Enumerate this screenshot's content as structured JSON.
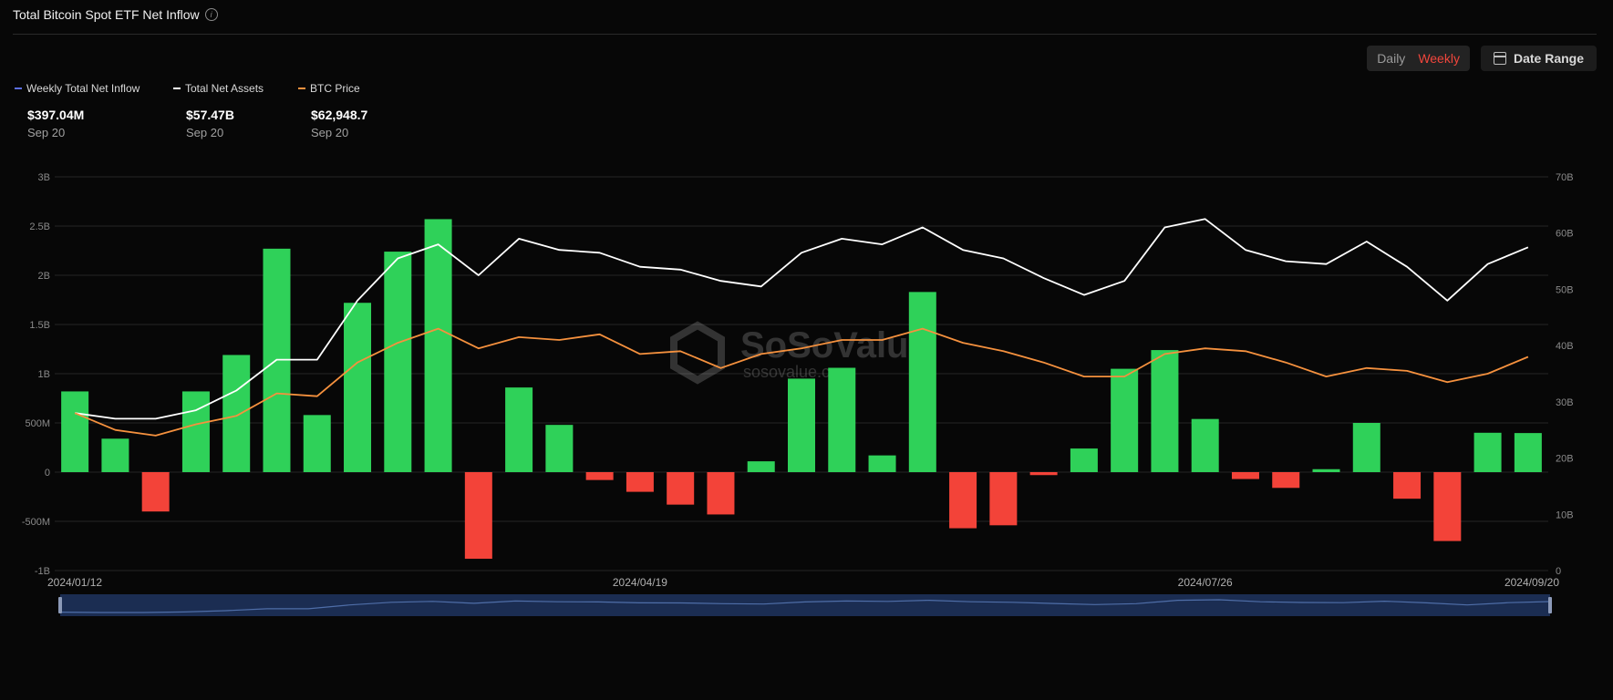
{
  "header": {
    "title": "Total Bitcoin Spot ETF Net Inflow",
    "info_icon": "i"
  },
  "controls": {
    "daily_label": "Daily",
    "weekly_label": "Weekly",
    "date_range_label": "Date Range",
    "active": "Weekly"
  },
  "legend": [
    {
      "name": "Weekly Total Net Inflow",
      "value": "$397.04M",
      "date": "Sep 20",
      "color": "#5b6ee1"
    },
    {
      "name": "Total Net Assets",
      "value": "$57.47B",
      "date": "Sep 20",
      "color": "#ffffff"
    },
    {
      "name": "BTC Price",
      "value": "$62,948.7",
      "date": "Sep 20",
      "color": "#f5913e"
    }
  ],
  "watermark": {
    "brand": "SoSoValue",
    "domain": "sosovalue.com"
  },
  "chart_data": {
    "type": "bar",
    "title": "Total Bitcoin Spot ETF Net Inflow",
    "left_axis": {
      "ticks": [
        "3B",
        "2.5B",
        "2B",
        "1.5B",
        "1B",
        "500M",
        "0",
        "-500M",
        "-1B"
      ],
      "range": [
        -1000,
        3000
      ],
      "unit": "M"
    },
    "right_axis": {
      "ticks": [
        "70B",
        "60B",
        "50B",
        "40B",
        "30B",
        "20B",
        "10B",
        "0"
      ],
      "range": [
        0,
        70
      ],
      "unit": "B"
    },
    "x_tick_labels": [
      "2024/01/12",
      "2024/04/19",
      "2024/07/26",
      "2024/09/20"
    ],
    "colors": {
      "positive": "#2fd159",
      "negative": "#f34339",
      "assets": "#ffffff",
      "price": "#f5913e"
    },
    "grid": true,
    "series": [
      {
        "name": "Weekly Total Net Inflow",
        "axis": "left",
        "values": [
          820,
          340,
          -400,
          820,
          1190,
          2270,
          580,
          1720,
          2240,
          2570,
          -880,
          860,
          480,
          -80,
          -200,
          -330,
          -430,
          110,
          950,
          1060,
          170,
          1830,
          -570,
          -540,
          -30,
          240,
          1050,
          1240,
          540,
          -70,
          -160,
          30,
          500,
          -270,
          -700,
          400,
          397
        ]
      },
      {
        "name": "Total Net Assets",
        "axis": "right",
        "values": [
          28,
          27,
          27,
          28.5,
          32,
          37.5,
          37.5,
          48,
          55.5,
          58,
          52.5,
          59,
          57,
          56.5,
          54,
          53.5,
          51.5,
          50.5,
          56.5,
          59,
          58,
          61,
          57,
          55.5,
          52,
          49,
          51.5,
          61,
          62.5,
          57,
          55,
          54.5,
          58.5,
          54,
          48,
          54.5,
          57.47
        ]
      },
      {
        "name": "BTC Price",
        "axis": "right",
        "values": [
          28,
          25,
          24,
          26,
          27.5,
          31.5,
          31,
          37,
          40.5,
          43,
          39.5,
          41.5,
          41,
          42,
          38.5,
          39,
          36,
          38.5,
          39.5,
          41,
          41,
          43,
          40.5,
          39,
          37,
          34.5,
          34.5,
          38.5,
          39.5,
          39,
          37,
          34.5,
          36,
          35.5,
          33.5,
          35,
          38
        ]
      }
    ]
  }
}
